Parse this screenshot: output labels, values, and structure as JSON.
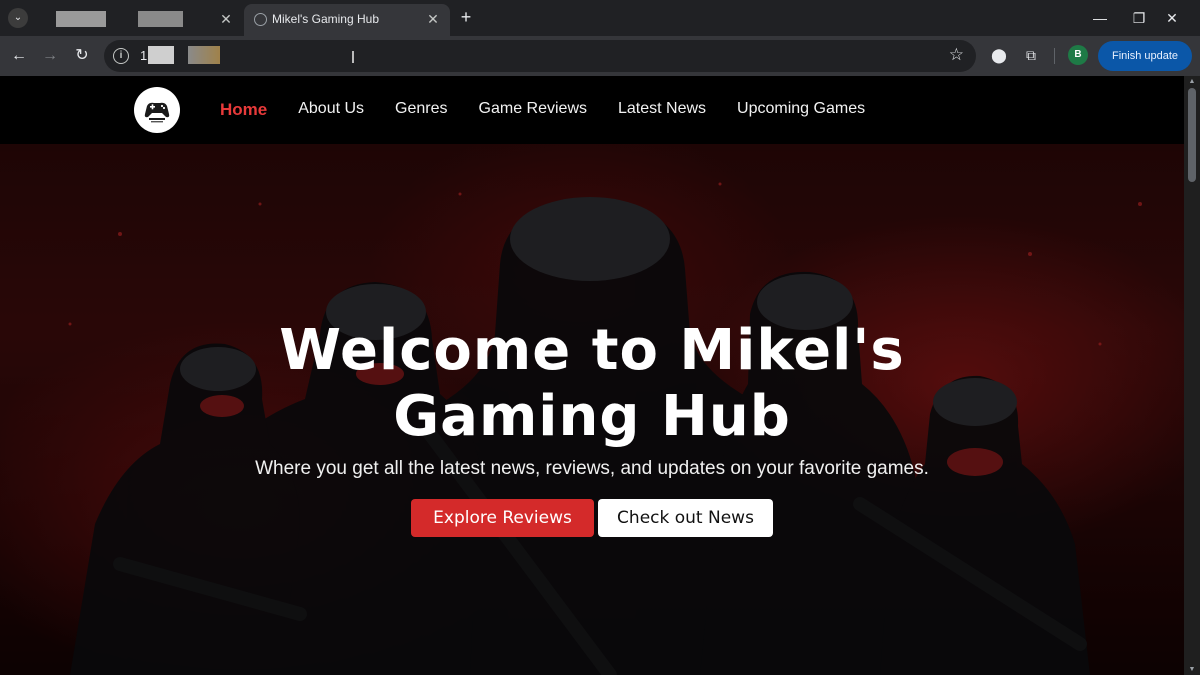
{
  "browser": {
    "tabs": [
      {
        "title": "",
        "active": false
      },
      {
        "title": "Mikel's Gaming Hub",
        "active": true
      }
    ],
    "address_bar": {
      "url": "1"
    },
    "finish_update_label": "Finish update",
    "profile_initial": "B"
  },
  "site": {
    "nav": {
      "items": [
        {
          "label": "Home",
          "active": true
        },
        {
          "label": "About Us",
          "active": false
        },
        {
          "label": "Genres",
          "active": false
        },
        {
          "label": "Game Reviews",
          "active": false
        },
        {
          "label": "Latest News",
          "active": false
        },
        {
          "label": "Upcoming Games",
          "active": false
        }
      ]
    },
    "hero": {
      "title": "Welcome to Mikel's Gaming Hub",
      "subtitle": "Where you get all the latest news, reviews, and updates on your favorite games.",
      "primary_button": "Explore Reviews",
      "secondary_button": "Check out News"
    }
  },
  "colors": {
    "accent": "#e83a3a",
    "primary_button": "#d42a2a",
    "finish_update": "#0b57a8"
  }
}
